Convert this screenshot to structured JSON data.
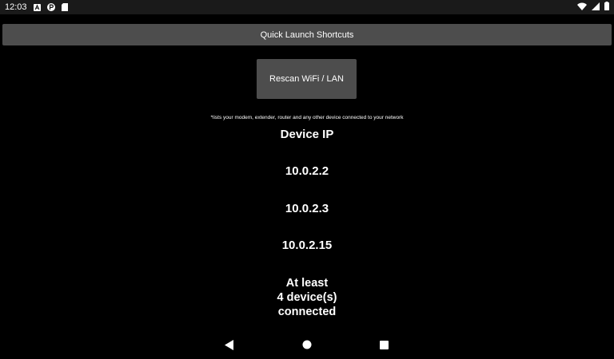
{
  "status_bar": {
    "time": "12:03",
    "left_icons": [
      "a-notification-icon",
      "p-notification-icon",
      "sd-card-icon"
    ],
    "right_icons": [
      "wifi-icon",
      "signal-icon",
      "battery-icon"
    ]
  },
  "header": {
    "quick_launch_label": "Quick Launch Shortcuts"
  },
  "actions": {
    "rescan_label": "Rescan WiFi / LAN"
  },
  "note": "*lists your modem, extender, router and any other device connected to your network",
  "devices": {
    "header": "Device IP",
    "items": [
      "10.0.2.2",
      "10.0.2.3",
      "10.0.2.15"
    ],
    "summary_lines": [
      "At least",
      "4 device(s)",
      "connected"
    ]
  },
  "nav": {
    "icons": [
      "back-icon",
      "home-icon",
      "recents-icon"
    ]
  },
  "colors": {
    "background": "#000000",
    "button": "#4d4d4d",
    "text": "#ffffff"
  }
}
